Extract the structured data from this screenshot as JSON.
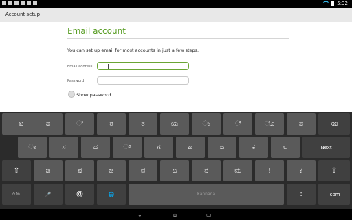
{
  "status_bar": {
    "time": "5:32"
  },
  "action_bar": {
    "title": "Account setup"
  },
  "form": {
    "heading": "Email account",
    "description": "You can set up email for most accounts in just a few steps.",
    "email_label": "Email address",
    "email_value": "",
    "password_label": "Password",
    "password_value": "",
    "show_password_label": "Show password.",
    "show_password_checked": false
  },
  "keyboard": {
    "language": "Kannada",
    "row1": [
      "ಟ",
      "ಡ",
      "ಿ",
      "ರ",
      "ತ",
      "ಯ",
      "ು",
      "ೆ",
      "ೊ",
      "ಪ",
      "⌫"
    ],
    "row2": [
      "ಾ",
      "ಸ",
      "ದ",
      "್",
      "ಗ",
      "ಹ",
      "ಜ",
      "ಕ",
      "ಲ",
      "Next"
    ],
    "row3": [
      "⇧",
      "ಙ",
      "ಷ",
      "ಚ",
      "ವ",
      "ಬ",
      "ನ",
      "ಮ",
      "!",
      "?",
      "⇧"
    ],
    "row4": [
      "೧೨೩",
      "🎤",
      "@",
      "🌐",
      "",
      ":",
      "/",
      ".com"
    ]
  },
  "nav_bar": {
    "back_icon": "back",
    "home_icon": "home",
    "recents_icon": "recents"
  }
}
